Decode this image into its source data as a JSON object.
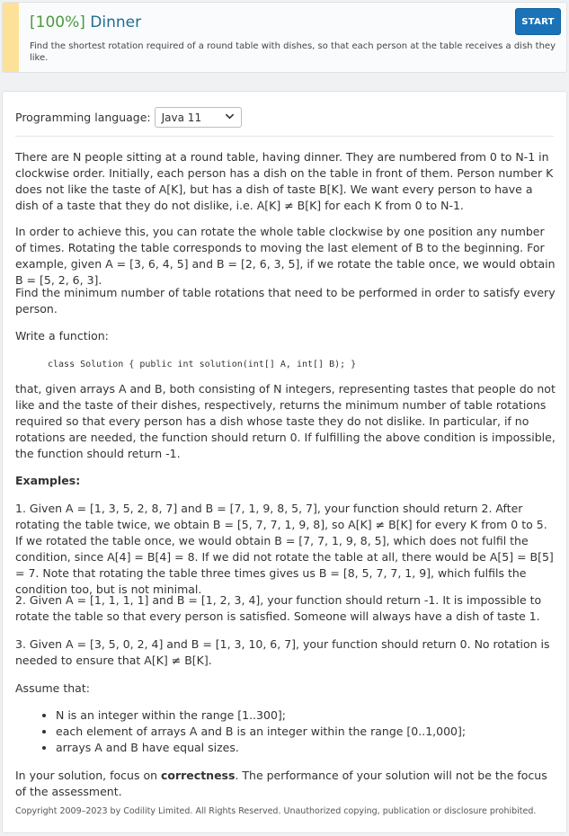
{
  "header": {
    "score": "[100%]",
    "title": "Dinner",
    "summary": "Find the shortest rotation required of a round table with dishes, so that each person at the table receives a dish they like.",
    "start_label": "START"
  },
  "language": {
    "label": "Programming language:",
    "selected": "Java 11"
  },
  "description": {
    "p1": "There are N people sitting at a round table, having dinner. They are numbered from 0 to N-1 in clockwise order. Initially, each person has a dish on the table in front of them. Person number K does not like the taste of A[K], but has a dish of taste B[K]. We want every person to have a dish of a taste that they do not dislike, i.e. A[K] ≠ B[K] for each K from 0 to N-1.",
    "p2": "In order to achieve this, you can rotate the whole table clockwise by one position any number of times. Rotating the table corresponds to moving the last element of B to the beginning. For example, given A = [3, 6, 4, 5] and B = [2, 6, 3, 5], if we rotate the table once, we would obtain B = [5, 2, 6, 3].",
    "p3": "Find the minimum number of table rotations that need to be performed in order to satisfy every person.",
    "p4": "Write a function:",
    "code": "class Solution { public int solution(int[] A, int[] B); }",
    "p5": "that, given arrays A and B, both consisting of N integers, representing tastes that people do not like and the taste of their dishes, respectively, returns the minimum number of table rotations required so that every person has a dish whose taste they do not dislike. In particular, if no rotations are needed, the function should return 0. If fulfilling the above condition is impossible, the function should return -1.",
    "examples_heading": "Examples:",
    "ex1": "1. Given A = [1, 3, 5, 2, 8, 7] and B = [7, 1, 9, 8, 5, 7], your function should return 2. After rotating the table twice, we obtain B = [5, 7, 7, 1, 9, 8], so A[K] ≠ B[K] for every K from 0 to 5. If we rotated the table once, we would obtain B = [7, 7, 1, 9, 8, 5], which does not fulfil the condition, since A[4] = B[4] = 8. If we did not rotate the table at all, there would be A[5] = B[5] = 7. Note that rotating the table three times gives us B = [8, 5, 7, 7, 1, 9], which fulfils the condition too, but is not minimal.",
    "ex2": "2. Given A = [1, 1, 1, 1] and B = [1, 2, 3, 4], your function should return -1. It is impossible to rotate the table so that every person is satisfied. Someone will always have a dish of taste 1.",
    "ex3": "3. Given A = [3, 5, 0, 2, 4] and B = [1, 3, 10, 6, 7], your function should return 0. No rotation is needed to ensure that A[K] ≠ B[K].",
    "assume": "Assume that:",
    "assumptions": [
      "N is an integer within the range [1..300];",
      "each element of arrays A and B is an integer within the range [0..1,000];",
      "arrays A and B have equal sizes."
    ],
    "focus_pre": "In your solution, focus on ",
    "focus_bold": "correctness",
    "focus_post": ". The performance of your solution will not be the focus of the assessment."
  },
  "copyright": "Copyright 2009–2023 by Codility Limited. All Rights Reserved. Unauthorized copying, publication or disclosure prohibited."
}
